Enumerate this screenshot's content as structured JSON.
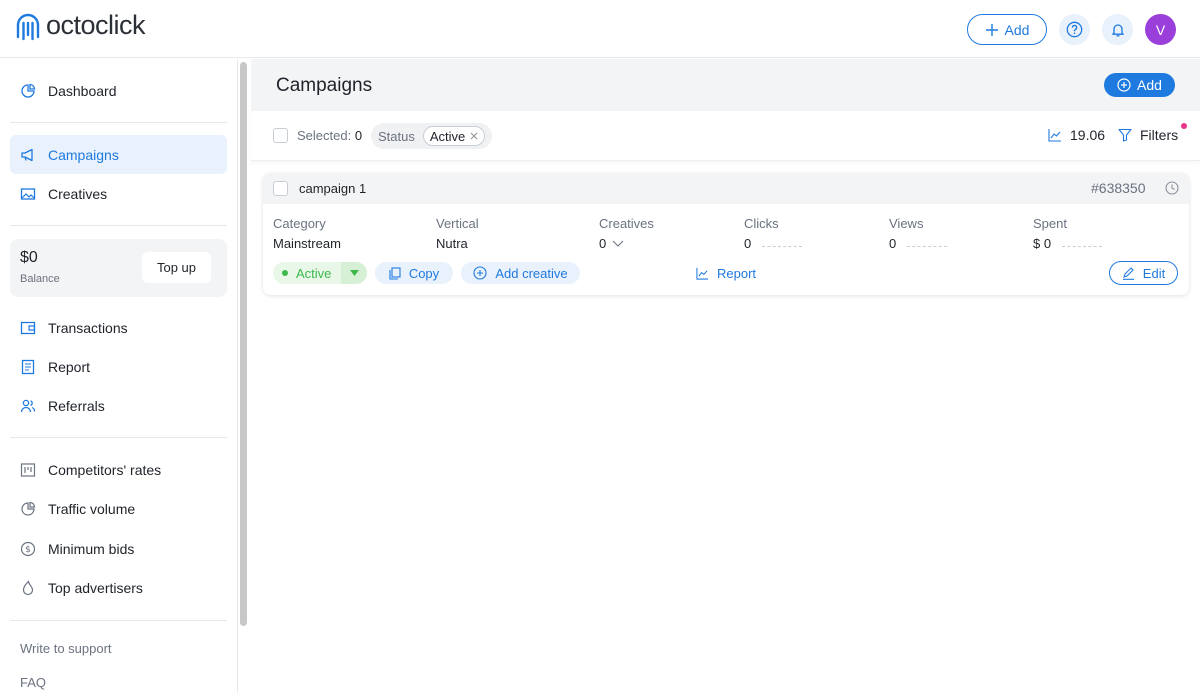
{
  "header": {
    "logo_text": "octoclick",
    "add_label": "Add",
    "avatar_initial": "V"
  },
  "sidebar": {
    "items": [
      {
        "label": "Dashboard",
        "icon": "pie-chart-icon"
      },
      {
        "label": "Campaigns",
        "icon": "megaphone-icon",
        "active": true
      },
      {
        "label": "Creatives",
        "icon": "image-icon"
      },
      {
        "label": "Transactions",
        "icon": "wallet-icon"
      },
      {
        "label": "Report",
        "icon": "document-icon"
      },
      {
        "label": "Referrals",
        "icon": "users-icon"
      },
      {
        "label": "Competitors' rates",
        "icon": "bars-icon"
      },
      {
        "label": "Traffic volume",
        "icon": "pie-chart-icon"
      },
      {
        "label": "Minimum bids",
        "icon": "dollar-icon"
      },
      {
        "label": "Top advertisers",
        "icon": "flame-icon"
      }
    ],
    "balance": {
      "amount": "$0",
      "label": "Balance",
      "topup_label": "Top up"
    },
    "links": [
      "Write to support",
      "FAQ"
    ]
  },
  "main": {
    "title": "Campaigns",
    "add_label": "Add",
    "filters": {
      "selected_label": "Selected:",
      "selected_count": "0",
      "status_label": "Status",
      "status_value": "Active",
      "ctr_value": "19.06",
      "filters_label": "Filters"
    },
    "campaigns": [
      {
        "name": "campaign 1",
        "id": "#638350",
        "columns": [
          {
            "label": "Category",
            "value": "Mainstream"
          },
          {
            "label": "Vertical",
            "value": "Nutra"
          },
          {
            "label": "Creatives",
            "value": "0"
          },
          {
            "label": "Clicks",
            "value": "0"
          },
          {
            "label": "Views",
            "value": "0"
          },
          {
            "label": "Spent",
            "value": "$ 0"
          }
        ],
        "status": "Active",
        "actions": {
          "copy": "Copy",
          "add_creative": "Add creative",
          "report": "Report",
          "edit": "Edit"
        }
      }
    ]
  },
  "colors": {
    "accent": "#1f7ae0",
    "active_green": "#3cb94a",
    "avatar": "#9b3fdb",
    "filter_dot": "#e8348a"
  }
}
